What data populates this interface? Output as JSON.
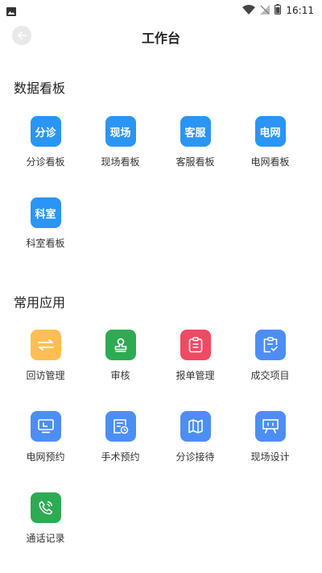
{
  "status_bar": {
    "time": "16:11"
  },
  "header": {
    "title": "工作台"
  },
  "sections": {
    "dashboards": {
      "title": "数据看板",
      "items": [
        {
          "tile_text": "分诊",
          "label": "分诊看板",
          "color": "#2b95f5"
        },
        {
          "tile_text": "现场",
          "label": "现场看板",
          "color": "#2b95f5"
        },
        {
          "tile_text": "客服",
          "label": "客服看板",
          "color": "#2b95f5"
        },
        {
          "tile_text": "电网",
          "label": "电网看板",
          "color": "#2b95f5"
        },
        {
          "tile_text": "科室",
          "label": "科室看板",
          "color": "#2b95f5"
        }
      ]
    },
    "apps": {
      "title": "常用应用",
      "items": [
        {
          "label": "回访管理",
          "icon": "swap-arrows-icon",
          "color": "#ffbe55"
        },
        {
          "label": "审核",
          "icon": "stamp-icon",
          "color": "#2eaa52"
        },
        {
          "label": "报单管理",
          "icon": "clipboard-icon",
          "color": "#ef4a63"
        },
        {
          "label": "成交项目",
          "icon": "checklist-icon",
          "color": "#4d8ef5"
        },
        {
          "label": "电网预约",
          "icon": "monitor-icon",
          "color": "#4d8ef5"
        },
        {
          "label": "手术预约",
          "icon": "schedule-doc-icon",
          "color": "#4d8ef5"
        },
        {
          "label": "分诊接待",
          "icon": "map-icon",
          "color": "#4d8ef5"
        },
        {
          "label": "现场设计",
          "icon": "easel-icon",
          "color": "#4d8ef5"
        },
        {
          "label": "通话记录",
          "icon": "phone-icon",
          "color": "#2eaa52"
        }
      ]
    }
  }
}
